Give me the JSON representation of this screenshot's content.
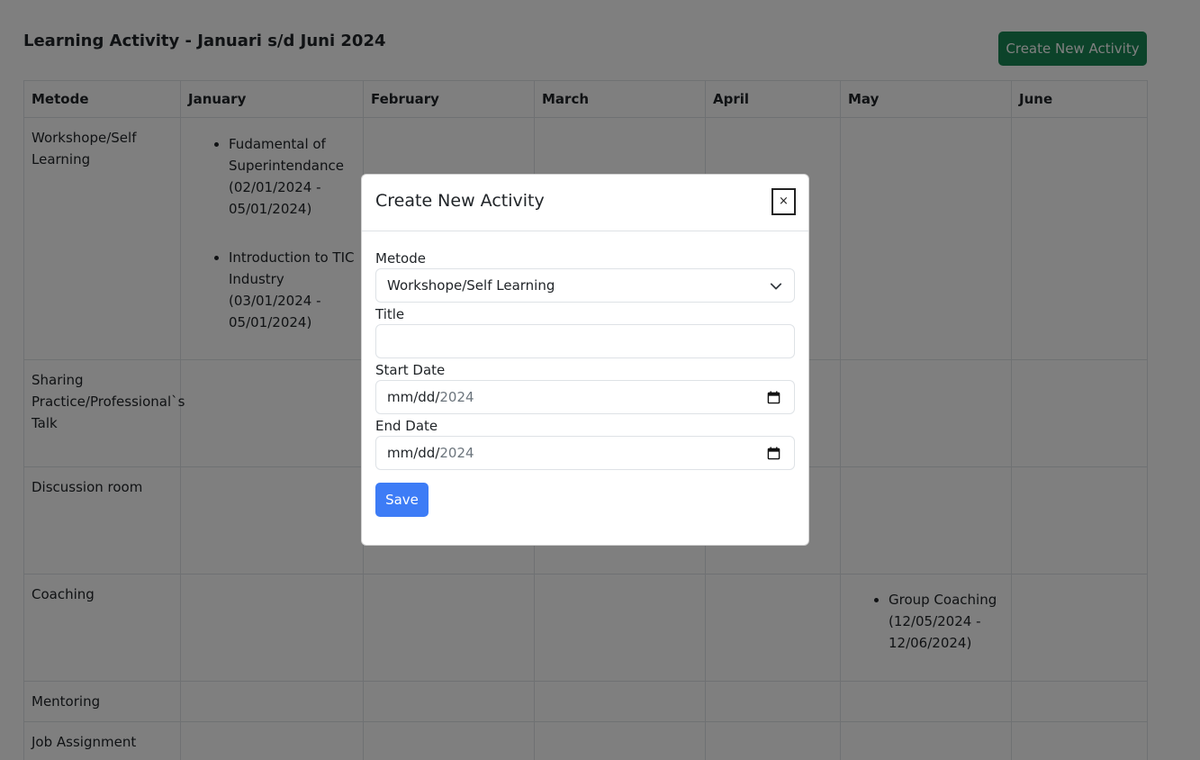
{
  "page": {
    "title": "Learning Activity - Januari s/d Juni 2024",
    "create_button": "Create New Activity"
  },
  "table": {
    "headers": [
      "Metode",
      "January",
      "February",
      "March",
      "April",
      "May",
      "June"
    ],
    "rows": [
      {
        "method": "Workshope/Self Learning",
        "cells": {
          "january": [
            "Fudamental of Superintendance (02/01/2024 - 05/01/2024)",
            "Introduction to TIC Industry (03/01/2024 - 05/01/2024)"
          ]
        }
      },
      {
        "method": "Sharing Practice/Professional`s Talk",
        "cells": {}
      },
      {
        "method": "Discussion room",
        "cells": {}
      },
      {
        "method": "Coaching",
        "cells": {
          "may": [
            "Group Coaching (12/05/2024 - 12/06/2024)"
          ]
        }
      },
      {
        "method": "Mentoring",
        "cells": {}
      },
      {
        "method": "Job Assignment",
        "cells": {}
      }
    ]
  },
  "modal": {
    "title": "Create New Activity",
    "close_label": "×",
    "metode_label": "Metode",
    "metode_value": "Workshope/Self Learning",
    "title_label": "Title",
    "title_value": "",
    "start_label": "Start Date",
    "start_value_prefix": "mm/dd/",
    "start_value_year": "2024",
    "end_label": "End Date",
    "end_value_prefix": "mm/dd/",
    "end_value_year": "2024",
    "save_label": "Save"
  },
  "icons": {
    "select": "chevron-down-icon",
    "date": "calendar-icon",
    "close": "close-icon"
  },
  "colors": {
    "create_button": "#198754",
    "save_button": "#3d7cf6",
    "backdrop": "rgba(0,0,0,0.5)"
  }
}
